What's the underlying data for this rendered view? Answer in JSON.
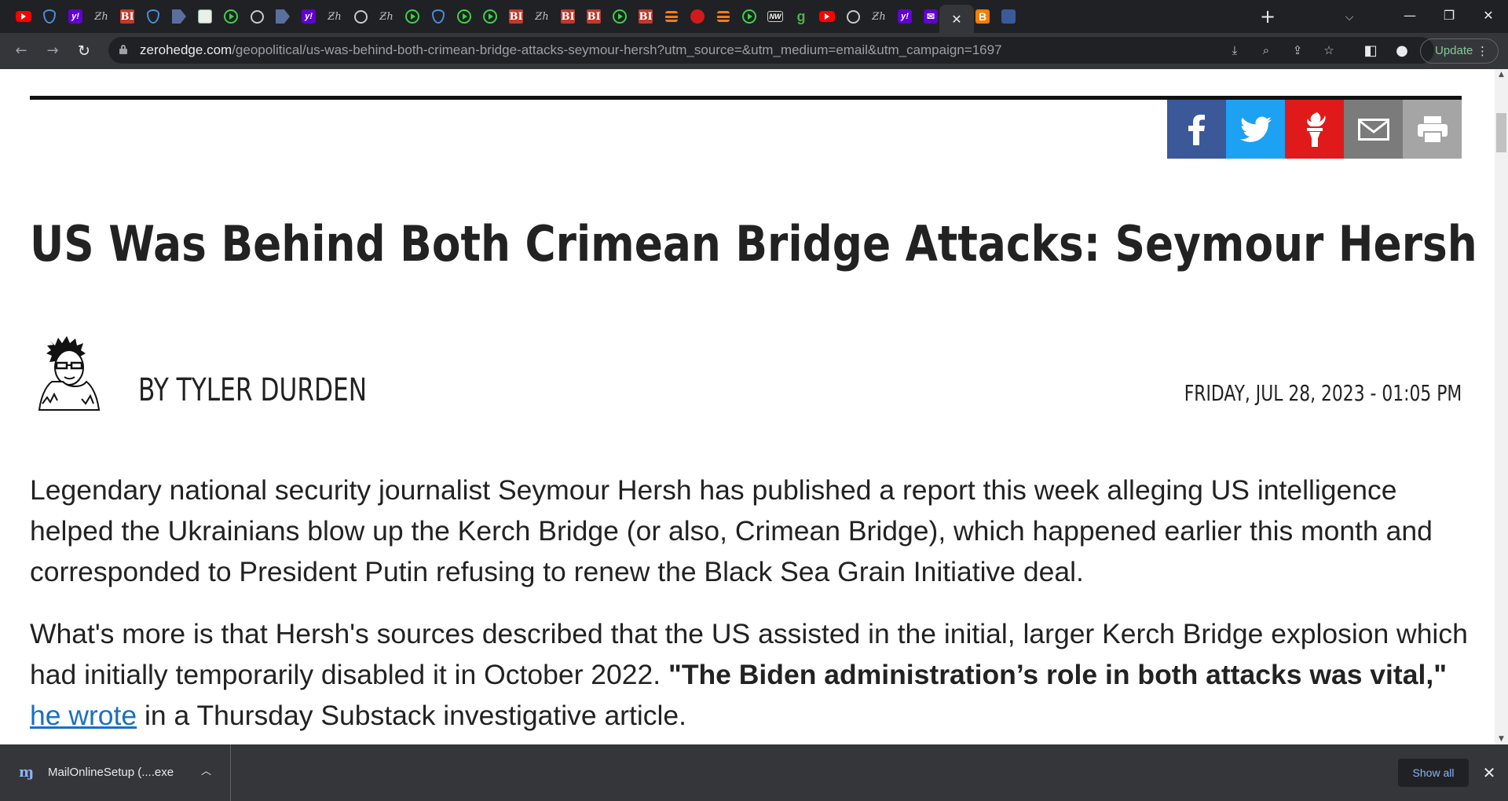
{
  "browser": {
    "tabs": [
      {
        "icon": "youtube-icon",
        "kind": "yt",
        "glyph": ""
      },
      {
        "icon": "shield-icon",
        "kind": "shield",
        "glyph": ""
      },
      {
        "icon": "yahoo-icon",
        "kind": "yh",
        "glyph": "y!"
      },
      {
        "icon": "zerohedge-icon",
        "kind": "zh",
        "glyph": "Ƶh"
      },
      {
        "icon": "business-insider-icon",
        "kind": "bi",
        "glyph": "BI"
      },
      {
        "icon": "shield-icon",
        "kind": "shield",
        "glyph": ""
      },
      {
        "icon": "arrow-icon",
        "kind": "arrow",
        "glyph": ""
      },
      {
        "icon": "grid-icon",
        "kind": "grid",
        "glyph": ""
      },
      {
        "icon": "rumble-icon",
        "kind": "play",
        "glyph": ""
      },
      {
        "icon": "globe-icon",
        "kind": "globe",
        "glyph": ""
      },
      {
        "icon": "arrow-icon",
        "kind": "arrow",
        "glyph": ""
      },
      {
        "icon": "yahoo-icon",
        "kind": "yh",
        "glyph": "y!"
      },
      {
        "icon": "zerohedge-icon",
        "kind": "zh",
        "glyph": "Ƶh"
      },
      {
        "icon": "globe-icon",
        "kind": "globe",
        "glyph": ""
      },
      {
        "icon": "zerohedge-icon",
        "kind": "zh",
        "glyph": "Ƶh"
      },
      {
        "icon": "rumble-icon",
        "kind": "play",
        "glyph": ""
      },
      {
        "icon": "shield-icon",
        "kind": "shield",
        "glyph": ""
      },
      {
        "icon": "rumble-icon",
        "kind": "play",
        "glyph": ""
      },
      {
        "icon": "rumble-icon",
        "kind": "play",
        "glyph": ""
      },
      {
        "icon": "business-insider-icon",
        "kind": "bi",
        "glyph": "BI"
      },
      {
        "icon": "zerohedge-icon",
        "kind": "zh",
        "glyph": "Ƶh"
      },
      {
        "icon": "business-insider-icon",
        "kind": "bi",
        "glyph": "BI"
      },
      {
        "icon": "business-insider-icon",
        "kind": "bi",
        "glyph": "BI"
      },
      {
        "icon": "rumble-icon",
        "kind": "play",
        "glyph": ""
      },
      {
        "icon": "business-insider-icon",
        "kind": "bi",
        "glyph": "BI"
      },
      {
        "icon": "bars-icon",
        "kind": "bars",
        "glyph": ""
      },
      {
        "icon": "torch-icon",
        "kind": "torch",
        "glyph": ""
      },
      {
        "icon": "bars-icon",
        "kind": "bars",
        "glyph": ""
      },
      {
        "icon": "rumble-icon",
        "kind": "play",
        "glyph": ""
      },
      {
        "icon": "newsweek-icon",
        "kind": "nw",
        "glyph": "NW"
      },
      {
        "icon": "g-icon",
        "kind": "g",
        "glyph": "g"
      },
      {
        "icon": "youtube-icon",
        "kind": "yt",
        "glyph": ""
      },
      {
        "icon": "globe-icon",
        "kind": "globe",
        "glyph": ""
      },
      {
        "icon": "zerohedge-icon",
        "kind": "zh",
        "glyph": "Ƶh"
      },
      {
        "icon": "yahoo-icon",
        "kind": "yh",
        "glyph": "y!"
      },
      {
        "icon": "yahoo-mail-icon",
        "kind": "mail",
        "glyph": "✉"
      },
      {
        "icon": "close-icon",
        "kind": "active",
        "glyph": "✕"
      },
      {
        "icon": "blogger-icon",
        "kind": "blogger",
        "glyph": "B"
      },
      {
        "icon": "lock-icon",
        "kind": "lock",
        "glyph": ""
      }
    ],
    "new_tab": "+",
    "tab_search": "⌵",
    "window": {
      "minimize": "—",
      "restore": "❐",
      "close": "✕"
    },
    "url": {
      "host": "zerohedge.com",
      "path": "/geopolitical/us-was-behind-both-crimean-bridge-attacks-seymour-hersh?utm_source=&utm_medium=email&utm_campaign=1697"
    },
    "update_label": "Update"
  },
  "article": {
    "headline": "US Was Behind Both Crimean Bridge Attacks: Seymour Hersh",
    "byline": "BY TYLER DURDEN",
    "dateline": "FRIDAY, JUL 28, 2023 - 01:05 PM",
    "paragraph1": "Legendary national security journalist Seymour Hersh has published a report this week alleging US intelligence helped the Ukrainians blow up the Kerch Bridge (or also, Crimean Bridge), which happened earlier this month and corresponded to President Putin refusing to renew the Black Sea Grain Initiative deal.",
    "paragraph2_start": "What's more is that Hersh's sources described that the US assisted in the initial, larger Kerch Bridge explosion which had initially temporarily disabled it in October 2022. ",
    "paragraph2_quote": "\"The Biden administration’s role in both attacks was vital,\"",
    "paragraph2_link": "he wrote",
    "paragraph2_end": " in a Thursday Substack investigative article."
  },
  "share": [
    "facebook-icon",
    "twitter-icon",
    "zerohedge-torch-icon",
    "email-icon",
    "print-icon"
  ],
  "downloads": {
    "file_name": "MailOnlineSetup (....exe",
    "show_all": "Show all"
  },
  "colors": {
    "facebook": "#3b5998",
    "twitter": "#1da1f2",
    "zerohedge": "#e01a1a",
    "email": "#7b7b7b",
    "print": "#a5a5a5",
    "link": "#1a6fc1"
  }
}
